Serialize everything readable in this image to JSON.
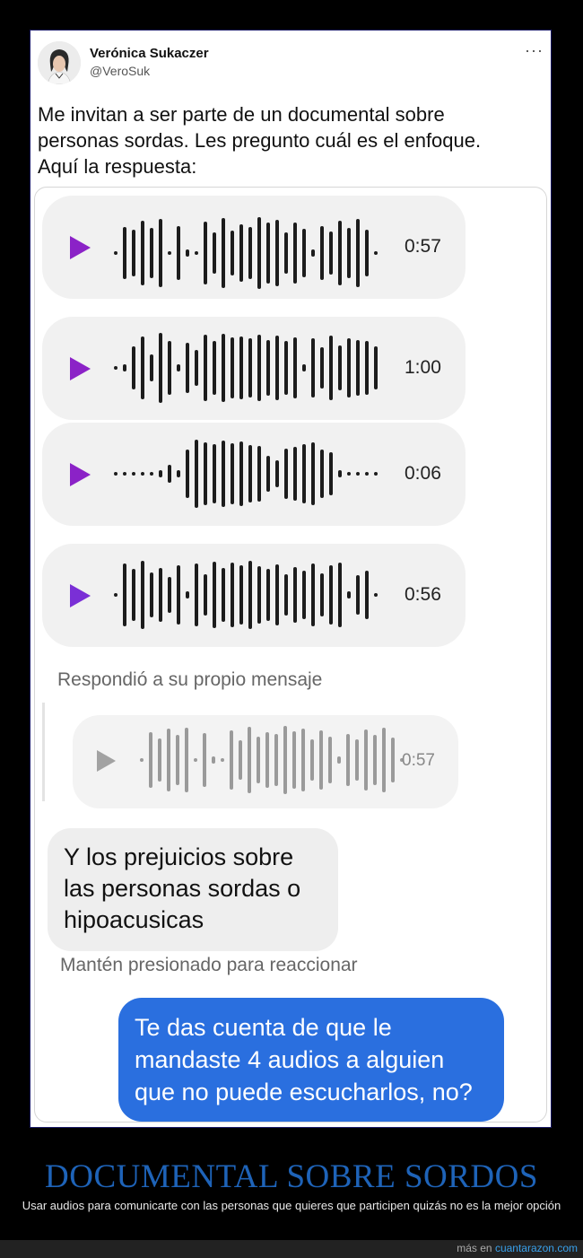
{
  "tweet": {
    "author_name": "Verónica Sukaczer",
    "author_handle": "@VeroSuk",
    "more_label": "···",
    "text": "Me invitan a ser parte de un documental sobre\npersonas sordas. Les pregunto cuál es el enfoque.\nAquí la respuesta:"
  },
  "chat": {
    "audios": [
      {
        "duration": "0:57",
        "play_color": "#8b22c7"
      },
      {
        "duration": "1:00",
        "play_color": "#8b22c7"
      },
      {
        "duration": "0:06",
        "play_color": "#8b22c7"
      },
      {
        "duration": "0:56",
        "play_color": "#7a2fd6"
      }
    ],
    "reply_note": "Respondió a su propio mensaje",
    "quoted_audio": {
      "duration": "0:57",
      "play_color": "#a2a2a2"
    },
    "incoming_message": "Y los prejuicios sobre\nlas personas sordas o\nhipoacusicas",
    "react_hint": "Mantén presionado para reaccionar",
    "outgoing_message": "Te das cuenta de que le\nmandaste 4 audios a alguien\nque no puede escucharlos, no?"
  },
  "caption": {
    "title": "DOCUMENTAL SOBRE SORDOS",
    "text": "Usar audios para comunicarte con las personas que quieres que participen quizás no es la mejor opción"
  },
  "footer": {
    "prefix": "más en ",
    "site": "cuantarazon.com"
  },
  "colors": {
    "outgoing_bubble": "#2a6fdf",
    "caption_title": "#1e63b8",
    "footer_link": "#39a0ea"
  }
}
